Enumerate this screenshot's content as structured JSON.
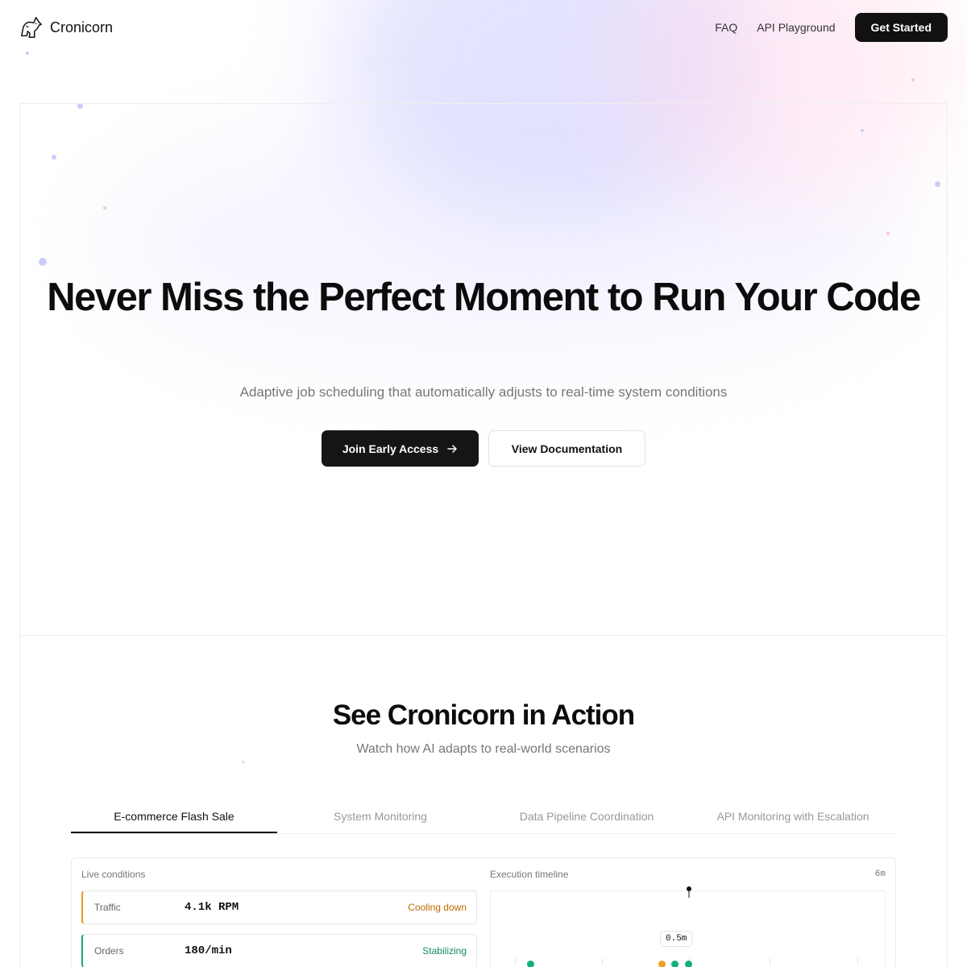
{
  "nav": {
    "brand": "Cronicorn",
    "links": [
      "FAQ",
      "API Playground"
    ],
    "cta": "Get Started"
  },
  "hero": {
    "title": "Never Miss the Perfect Moment to Run Your Code",
    "subtitle": "Adaptive job scheduling that automatically adjusts to real-time system conditions",
    "primary_cta": "Join Early Access",
    "secondary_cta": "View Documentation"
  },
  "demo": {
    "title": "See Cronicorn in Action",
    "subtitle": "Watch how AI adapts to real-world scenarios",
    "tabs": [
      {
        "label": "E-commerce Flash Sale",
        "active": true
      },
      {
        "label": "System Monitoring",
        "active": false
      },
      {
        "label": "Data Pipeline Coordination",
        "active": false
      },
      {
        "label": "API Monitoring with Escalation",
        "active": false
      }
    ],
    "live_conditions_label": "Live conditions",
    "conditions": [
      {
        "name": "Traffic",
        "value": "4.1k RPM",
        "status": "Cooling down",
        "tone": "orange"
      },
      {
        "name": "Orders",
        "value": "180/min",
        "status": "Stabilizing",
        "tone": "green"
      }
    ],
    "timeline": {
      "label": "Execution timeline",
      "range": "6m",
      "interval_badge": "0.5m"
    }
  },
  "colors": {
    "primary": "#111111",
    "warning": "#c26a00",
    "success": "#16875f",
    "dot_green": "#14b07a",
    "dot_orange": "#f0a020"
  }
}
